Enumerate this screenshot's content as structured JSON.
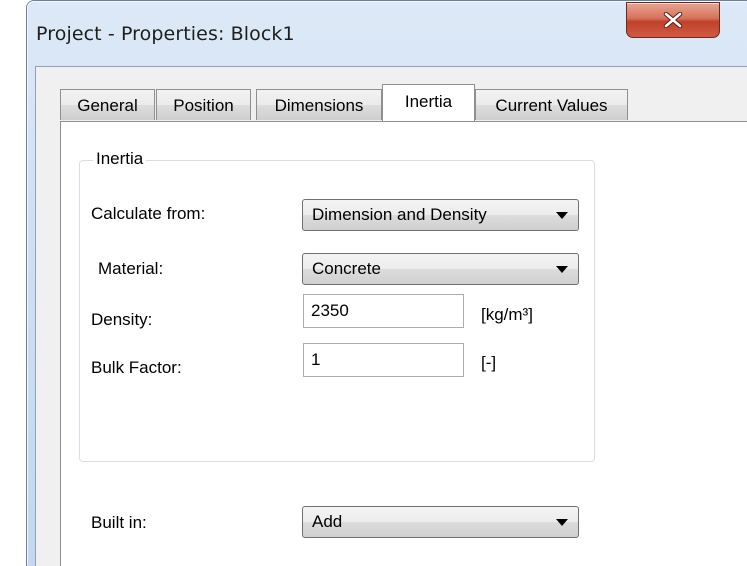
{
  "window": {
    "title": "Project - Properties: Block1",
    "close_icon": "close-x-icon"
  },
  "tabs": [
    {
      "label": "General",
      "active": false
    },
    {
      "label": "Position",
      "active": false
    },
    {
      "label": "Dimensions",
      "active": false
    },
    {
      "label": "Inertia",
      "active": true
    },
    {
      "label": "Current Values",
      "active": false
    }
  ],
  "inertia_group": {
    "legend": "Inertia",
    "calculate_from": {
      "label": "Calculate from:",
      "value": "Dimension and Density"
    },
    "material": {
      "label": "Material:",
      "value": "Concrete"
    },
    "density": {
      "label": "Density:",
      "value": "2350",
      "unit": "[kg/m³]"
    },
    "bulk_factor": {
      "label": "Bulk Factor:",
      "value": "1",
      "unit": "[-]"
    }
  },
  "built_in": {
    "label": "Built in:",
    "value": "Add"
  },
  "colors": {
    "close_button": "#c7452e",
    "frame": "#cfe0f2",
    "panel": "#ffffff"
  }
}
